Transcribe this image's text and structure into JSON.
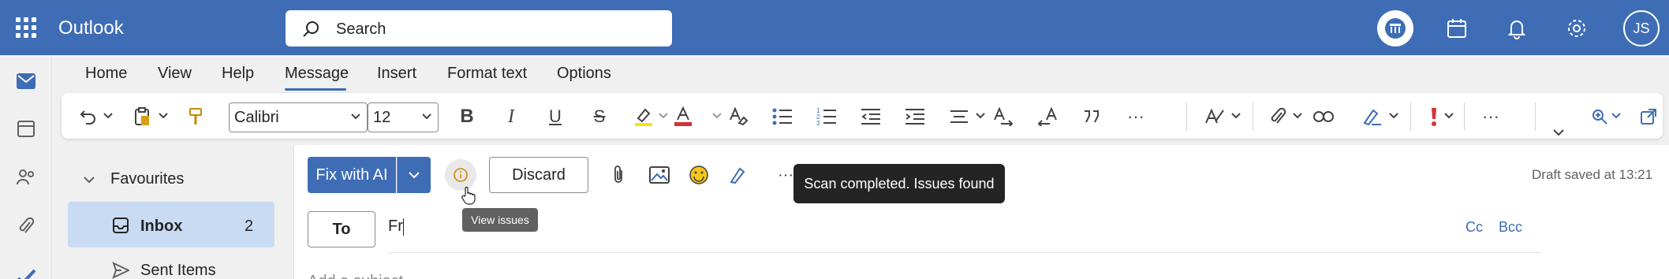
{
  "header": {
    "app_name": "Outlook",
    "search_placeholder": "Search",
    "avatar_initials": "JS"
  },
  "tabs": [
    {
      "label": "Home"
    },
    {
      "label": "View"
    },
    {
      "label": "Help"
    },
    {
      "label": "Message",
      "active": true
    },
    {
      "label": "Insert"
    },
    {
      "label": "Format text"
    },
    {
      "label": "Options"
    }
  ],
  "ribbon": {
    "font_name": "Calibri",
    "font_size": "12"
  },
  "folders": {
    "favourites_label": "Favourites",
    "inbox_label": "Inbox",
    "inbox_count": "2",
    "sent_label": "Sent Items"
  },
  "compose": {
    "fix_ai_label": "Fix with AI",
    "discard_label": "Discard",
    "scan_tooltip": "Scan completed. Issues found",
    "view_issues_tooltip": "View issues",
    "draft_status": "Draft saved at 13:21",
    "to_label": "To",
    "to_value": "Fr",
    "cc_label": "Cc",
    "bcc_label": "Bcc",
    "subject_placeholder": "Add a subject"
  },
  "colors": {
    "brand": "#3e6db5",
    "selected_folder": "#c9daf3"
  }
}
